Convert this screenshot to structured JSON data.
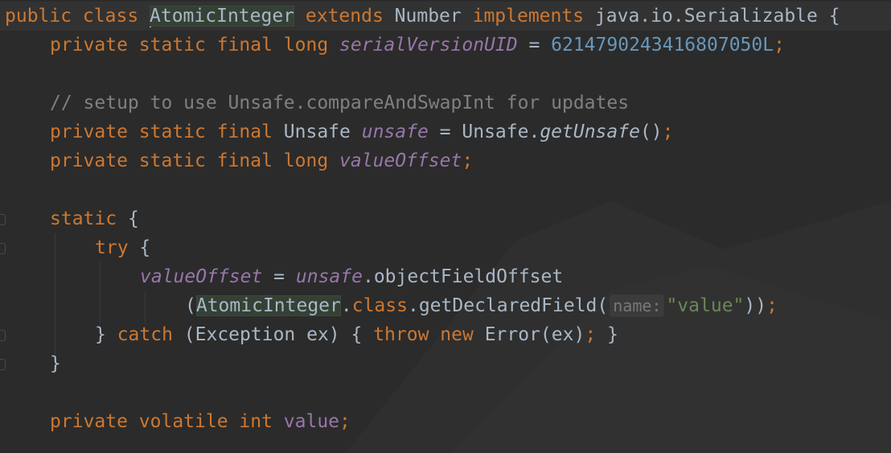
{
  "editor": {
    "language": "java",
    "theme_colors": {
      "background": "#2b2b2b",
      "keyword": "#cc7832",
      "field": "#9876aa",
      "number": "#6897bb",
      "comment": "#808080",
      "string": "#6a8759",
      "default": "#a9b7c6"
    },
    "lines": {
      "l1": {
        "kw1": "public class ",
        "classname": "AtomicInteger",
        "kw2": " extends ",
        "t1": "Number",
        "kw3": " implements ",
        "t2": "java.io.Serializable {"
      },
      "l2": {
        "kw": "private static final long ",
        "field": "serialVersionUID",
        "eq": " = ",
        "num": "6214790243416807050L",
        "semi": ";"
      },
      "l4": {
        "comment": "// setup to use Unsafe.compareAndSwapInt for updates"
      },
      "l5": {
        "kw": "private static final ",
        "type": "Unsafe ",
        "field": "unsafe",
        "eq": " = Unsafe.",
        "method": "getUnsafe",
        "paren": "()",
        "semi": ";"
      },
      "l6": {
        "kw": "private static final long ",
        "field": "valueOffset",
        "semi": ";"
      },
      "l8": {
        "kw": "static ",
        "brace": "{"
      },
      "l9": {
        "kw": "try ",
        "brace": "{"
      },
      "l10": {
        "field1": "valueOffset",
        "eq": " = ",
        "field2": "unsafe",
        "rest": ".objectFieldOffset"
      },
      "l11": {
        "open": "(",
        "classname": "AtomicInteger",
        "dot": ".",
        "kw": "class",
        "call": ".getDeclaredField(",
        "hint": "name:",
        "str": "\"value\"",
        "close": "))",
        "semi": ";"
      },
      "l12": {
        "brace1": "} ",
        "kw1": "catch ",
        "mid": "(Exception ex) { ",
        "kw2": "throw new ",
        "err": "Error(ex)",
        "semi": ";",
        "brace2": " }"
      },
      "l13": {
        "brace": "}"
      },
      "l15": {
        "kw": "private volatile int ",
        "field": "value",
        "semi": ";"
      }
    }
  }
}
